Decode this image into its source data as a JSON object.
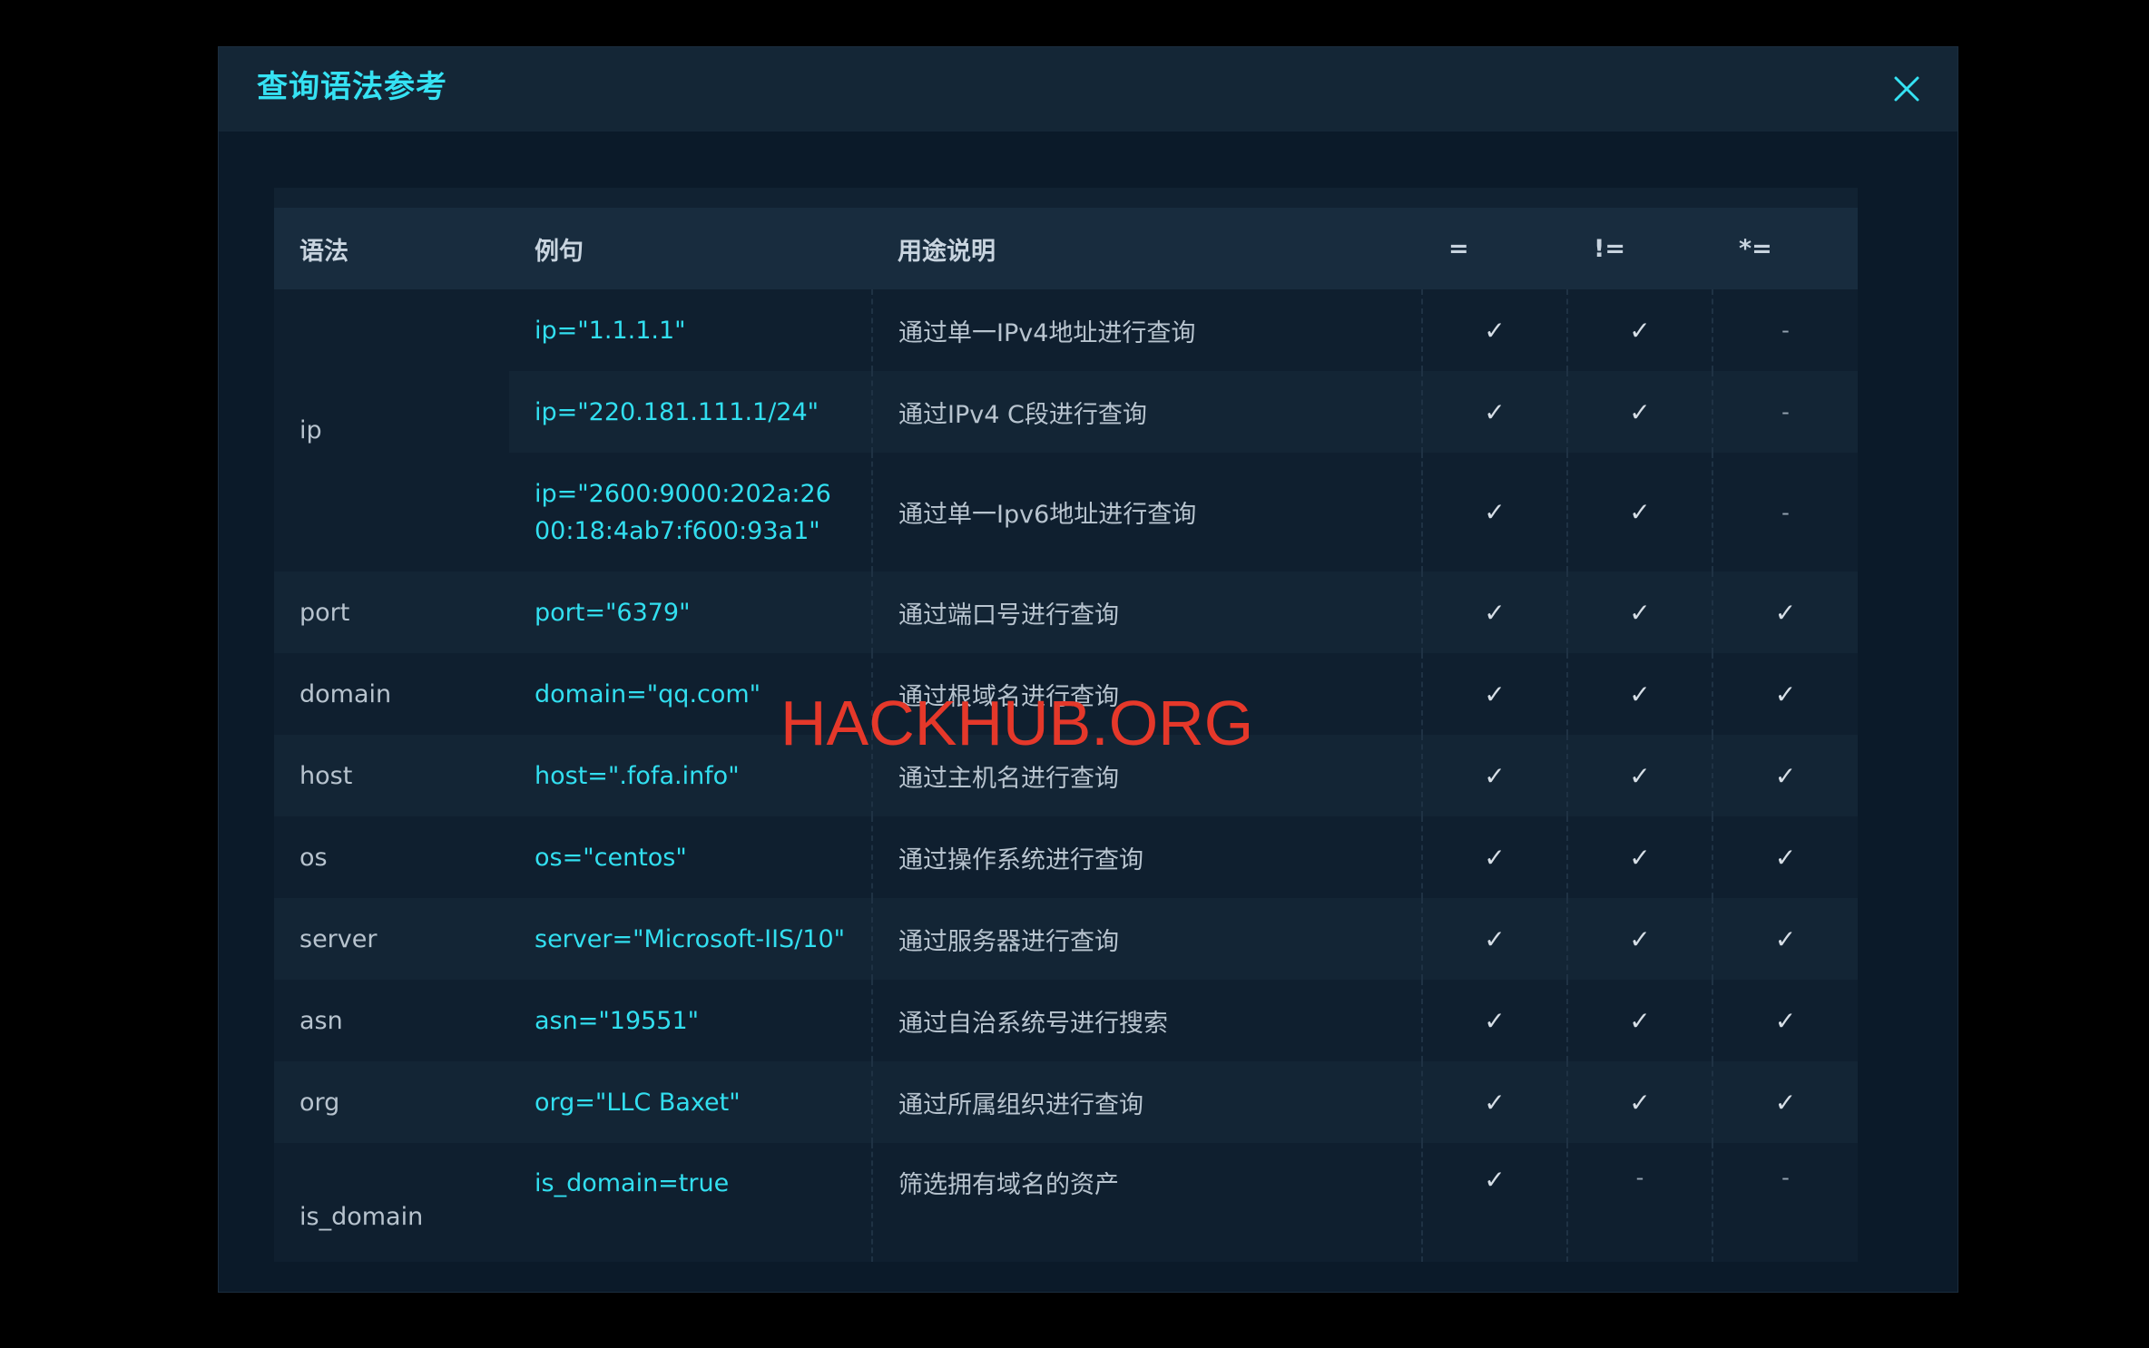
{
  "modal": {
    "title": "查询语法参考",
    "close_icon": "close-icon"
  },
  "table": {
    "headers": [
      "语法",
      "例句",
      "用途说明",
      "=",
      "!=",
      "*="
    ],
    "groups": [
      {
        "syntax": "ip",
        "rows": [
          {
            "example": "ip=\"1.1.1.1\"",
            "desc": "通过单一IPv4地址进行查询",
            "eq": "✓",
            "neq": "✓",
            "fuzzy": "-"
          },
          {
            "example": "ip=\"220.181.111.1/24\"",
            "desc": "通过IPv4 C段进行查询",
            "eq": "✓",
            "neq": "✓",
            "fuzzy": "-"
          },
          {
            "example": "ip=\"2600:9000:202a:2600:18:4ab7:f600:93a1\"",
            "desc": "通过单一Ipv6地址进行查询",
            "eq": "✓",
            "neq": "✓",
            "fuzzy": "-"
          }
        ]
      },
      {
        "syntax": "port",
        "rows": [
          {
            "example": "port=\"6379\"",
            "desc": "通过端口号进行查询",
            "eq": "✓",
            "neq": "✓",
            "fuzzy": "✓"
          }
        ]
      },
      {
        "syntax": "domain",
        "rows": [
          {
            "example": "domain=\"qq.com\"",
            "desc": "通过根域名进行查询",
            "eq": "✓",
            "neq": "✓",
            "fuzzy": "✓"
          }
        ]
      },
      {
        "syntax": "host",
        "rows": [
          {
            "example": "host=\".fofa.info\"",
            "desc": "通过主机名进行查询",
            "eq": "✓",
            "neq": "✓",
            "fuzzy": "✓"
          }
        ]
      },
      {
        "syntax": "os",
        "rows": [
          {
            "example": "os=\"centos\"",
            "desc": "通过操作系统进行查询",
            "eq": "✓",
            "neq": "✓",
            "fuzzy": "✓"
          }
        ]
      },
      {
        "syntax": "server",
        "rows": [
          {
            "example": "server=\"Microsoft-IIS/10\"",
            "desc": "通过服务器进行查询",
            "eq": "✓",
            "neq": "✓",
            "fuzzy": "✓"
          }
        ]
      },
      {
        "syntax": "asn",
        "rows": [
          {
            "example": "asn=\"19551\"",
            "desc": "通过自治系统号进行搜索",
            "eq": "✓",
            "neq": "✓",
            "fuzzy": "✓"
          }
        ]
      },
      {
        "syntax": "org",
        "rows": [
          {
            "example": "org=\"LLC Baxet\"",
            "desc": "通过所属组织进行查询",
            "eq": "✓",
            "neq": "✓",
            "fuzzy": "✓"
          }
        ]
      },
      {
        "syntax": "is_domain",
        "rows": [
          {
            "example": "is_domain=true",
            "desc": "筛选拥有域名的资产",
            "eq": "✓",
            "neq": "-",
            "fuzzy": "-"
          }
        ]
      }
    ]
  },
  "watermark": "HACKHUB.ORG",
  "colors": {
    "accent": "#35e2f3",
    "background": "#0b1a29",
    "header": "#142636",
    "watermark": "#e5382a"
  }
}
